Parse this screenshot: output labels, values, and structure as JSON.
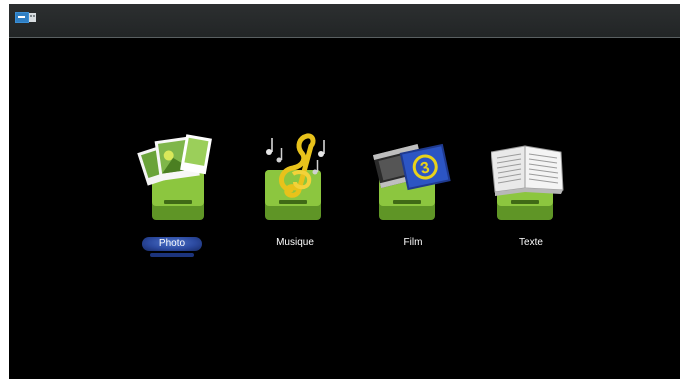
{
  "window": {
    "status_icon": "usb-drive-icon"
  },
  "menu": {
    "selected_index": 0,
    "items": [
      {
        "label": "Photo",
        "icon": "photo-folder-icon",
        "selected": true
      },
      {
        "label": "Musique",
        "icon": "music-folder-icon",
        "selected": false
      },
      {
        "label": "Film",
        "icon": "film-folder-icon",
        "selected": false
      },
      {
        "label": "Texte",
        "icon": "text-folder-icon",
        "selected": false
      }
    ]
  },
  "colors": {
    "background": "#000000",
    "topbar": "#2a2d2e",
    "folder_green": "#8cc63f",
    "selection_blue": "#2c4aa0",
    "label_text": "#ffffff"
  }
}
